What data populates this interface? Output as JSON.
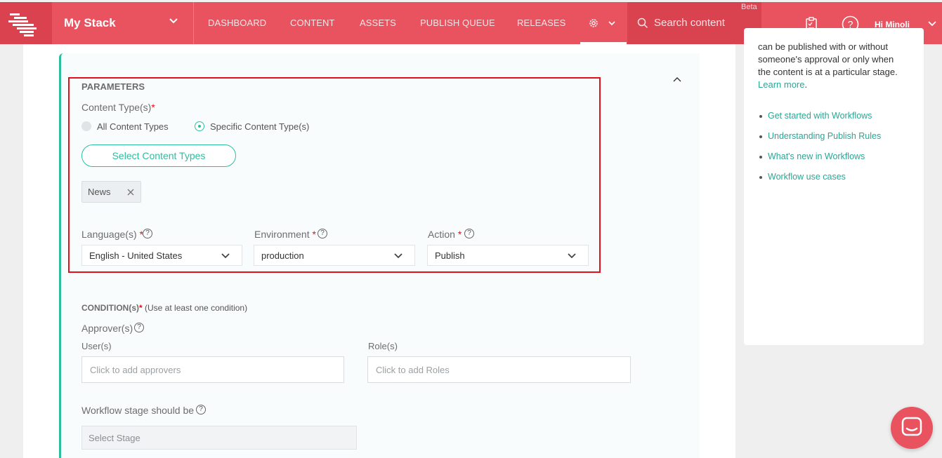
{
  "header": {
    "stack_name": "My Stack",
    "nav": [
      "DASHBOARD",
      "CONTENT",
      "ASSETS",
      "PUBLISH QUEUE",
      "RELEASES"
    ],
    "search_placeholder": "Search content",
    "beta_label": "Beta",
    "user_greeting": "Hi Minoli",
    "accent_color": "#e8535f"
  },
  "parameters": {
    "section_title": "PARAMETERS",
    "content_types_label": "Content Type(s)",
    "required_mark": "*",
    "radio_all": "All Content Types",
    "radio_specific": "Specific Content Type(s)",
    "selected_radio": "Specific Content Type(s)",
    "select_button": "Select Content Types",
    "tags": [
      "News"
    ],
    "language_label": "Language(s)",
    "language_value": "English - United States",
    "environment_label": "Environment",
    "environment_value": "production",
    "action_label": "Action",
    "action_value": "Publish"
  },
  "conditions": {
    "title": "CONDITION(s)",
    "required_mark": "*",
    "hint": "(Use at least one condition)",
    "approvers_label": "Approver(s)",
    "users_label": "User(s)",
    "users_placeholder": "Click to add approvers",
    "roles_label": "Role(s)",
    "roles_placeholder": "Click to add Roles",
    "stage_label": "Workflow stage should be",
    "stage_placeholder": "Select Stage"
  },
  "help": {
    "line1": "can be published with or without",
    "line2": "someone's approval or only when",
    "line3": "the content is at a particular stage.",
    "learn_more": "Learn more",
    "period": ".",
    "links": [
      "Get started with Workflows",
      "Understanding Publish Rules",
      "What's new in Workflows",
      "Workflow use cases"
    ]
  }
}
